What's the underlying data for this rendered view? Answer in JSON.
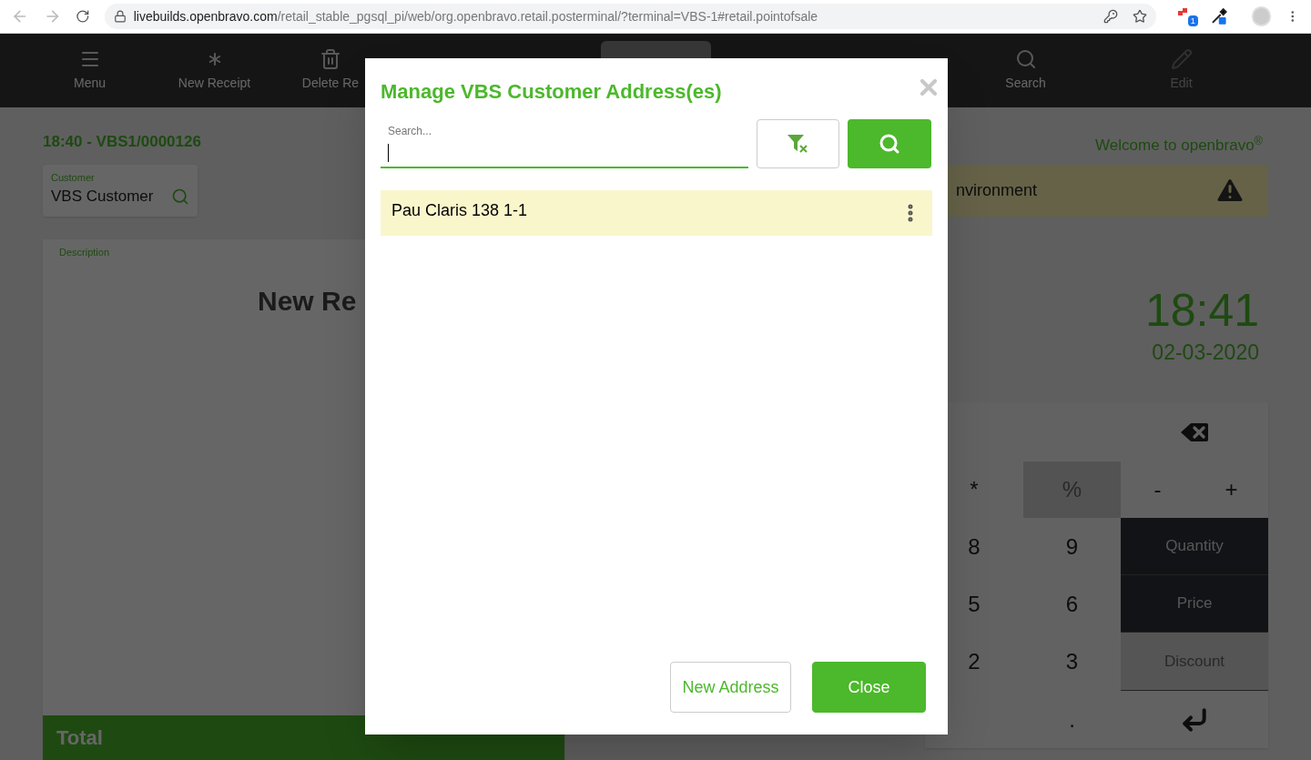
{
  "browser": {
    "url_host": "livebuilds.openbravo.com",
    "url_path": "/retail_stable_pgsql_pi/web/org.openbravo.retail.posterminal/?terminal=VBS-1#retail.pointofsale",
    "extension_badge": "1"
  },
  "toolbar": [
    {
      "label": "Menu",
      "disabled": false
    },
    {
      "label": "New Receipt",
      "disabled": false
    },
    {
      "label": "Delete Re",
      "disabled": false
    },
    {
      "label": "Search",
      "disabled": false
    },
    {
      "label": "Edit",
      "disabled": true
    }
  ],
  "receipt": {
    "header": "18:40 - VBS1/0000126",
    "customer_label": "Customer",
    "customer": "VBS Customer",
    "description_label": "Description",
    "empty_title": "New Re",
    "total_label": "Total"
  },
  "side": {
    "welcome": "Welcome to openbravo",
    "welcome_mark": "®",
    "banner": "nvironment",
    "time": "18:41",
    "date": "02-03-2020"
  },
  "keypad": [
    {
      "kind": "backspace"
    },
    {
      "kind": "key",
      "label": "*",
      "disabled": false
    },
    {
      "kind": "key",
      "label": "%",
      "disabled": true
    },
    {
      "kind": "key",
      "label": "-",
      "disabled": false
    },
    {
      "kind": "key",
      "label": "+",
      "disabled": false
    },
    {
      "kind": "key",
      "label": "8",
      "disabled": false
    },
    {
      "kind": "key",
      "label": "9",
      "disabled": false
    },
    {
      "kind": "mode",
      "label": "Quantity",
      "disabled": false
    },
    {
      "kind": "key",
      "label": "5",
      "disabled": false
    },
    {
      "kind": "key",
      "label": "6",
      "disabled": false
    },
    {
      "kind": "mode",
      "label": "Price",
      "disabled": false
    },
    {
      "kind": "key",
      "label": "2",
      "disabled": false
    },
    {
      "kind": "key",
      "label": "3",
      "disabled": false
    },
    {
      "kind": "mode",
      "label": "Discount",
      "disabled": true
    },
    {
      "kind": "key",
      "label": ".",
      "disabled": false
    },
    {
      "kind": "enter"
    }
  ],
  "dialog": {
    "title": "Manage VBS Customer Address(es)",
    "search_label": "Search...",
    "addresses": [
      {
        "text": "Pau Claris 138 1-1",
        "selected": true
      }
    ],
    "buttons": [
      {
        "label": "New Address",
        "kind": "secondary"
      },
      {
        "label": "Close",
        "kind": "primary"
      }
    ]
  }
}
